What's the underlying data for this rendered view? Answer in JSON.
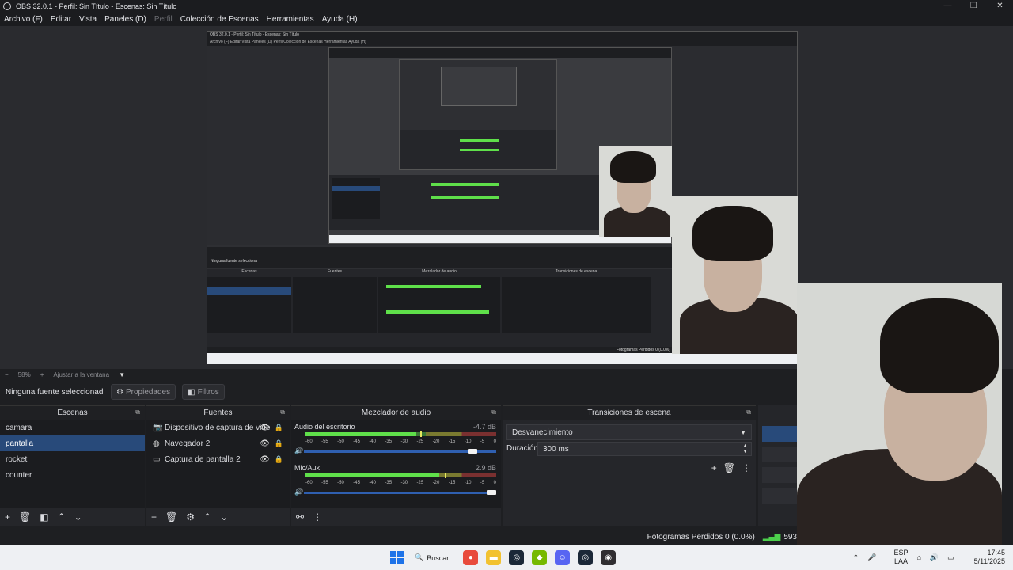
{
  "window": {
    "title": "OBS 32.0.1 - Perfil: Sin Título - Escenas: Sin Título",
    "controls": [
      "—",
      "❐",
      "✕"
    ]
  },
  "menu": {
    "items": [
      "Archivo (F)",
      "Editar",
      "Vista",
      "Paneles (D)",
      "Perfil",
      "Colección de Escenas",
      "Herramientas",
      "Ayuda (H)"
    ]
  },
  "nested_preview": {
    "title": "OBS 32.0.1 - Perfil: Sin Título - Escenas: Sin Título",
    "menu": "Archivo (F)   Editar   Vista   Paneles (D)   Perfil   Colección de Escenas   Herramientas   Ayuda (H)",
    "context": "Ninguna fuente selecciona",
    "dock_titles": [
      "Escenas",
      "Fuentes",
      "Mezclador de audio",
      "Transiciones de escena"
    ],
    "dropped": "Fotogramas Perdidos 0 (0.0%)"
  },
  "zoom": {
    "minus": "−",
    "level": "58%",
    "plus": "+",
    "fit": "Ajustar a la ventana"
  },
  "context": {
    "no_source": "Ninguna fuente seleccionad",
    "properties": "Propiedades",
    "filters": "Filtros"
  },
  "scenes": {
    "title": "Escenas",
    "items": [
      "camara",
      "pantalla",
      "rocket",
      "counter"
    ],
    "selected_index": 1
  },
  "sources": {
    "title": "Fuentes",
    "items": [
      {
        "label": "Dispositivo de captura de vide",
        "icon": "camera-icon"
      },
      {
        "label": "Navegador 2",
        "icon": "globe-icon"
      },
      {
        "label": "Captura de pantalla 2",
        "icon": "monitor-icon"
      }
    ]
  },
  "mixer": {
    "title": "Mezclador de audio",
    "channels": [
      {
        "name": "Audio del escritorio",
        "db": "-4.7 dB",
        "level": 0.58,
        "volume": 0.9
      },
      {
        "name": "Mic/Aux",
        "db": "2.9 dB",
        "level": 0.7,
        "volume": 1.0
      }
    ],
    "scale": [
      "-60",
      "-55",
      "-50",
      "-45",
      "-40",
      "-35",
      "-30",
      "-25",
      "-20",
      "-15",
      "-10",
      "-5",
      "0"
    ]
  },
  "transitions": {
    "title": "Transiciones de escena",
    "selected": "Desvanecimiento",
    "duration_label": "Duración",
    "duration_value": "300 ms"
  },
  "status": {
    "dropped_frames": "Fotogramas Perdidos 0 (0.0%)",
    "signal_value": "593"
  },
  "taskbar": {
    "search": "Buscar",
    "lang_top": "ESP",
    "lang_bottom": "LAA",
    "time": "17:45",
    "date": "5/11/2025"
  },
  "colors": {
    "accent_selected": "#284a7a",
    "meter_green": "#5fe04a",
    "volume_blue": "#2f5fb0"
  }
}
